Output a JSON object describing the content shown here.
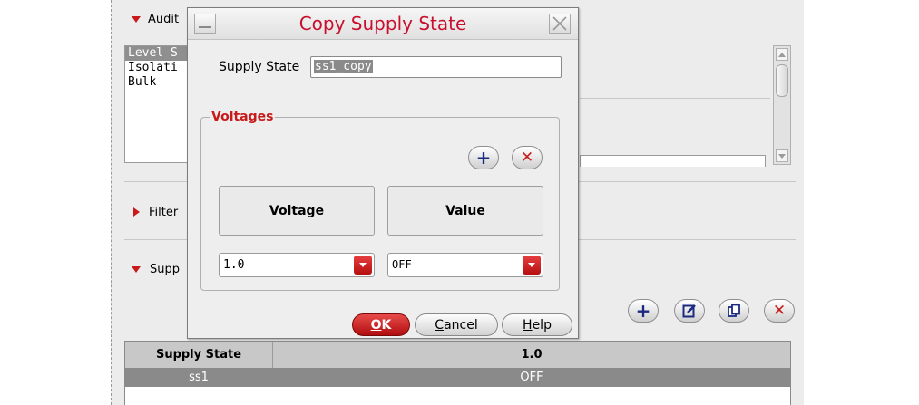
{
  "background": {
    "sections": {
      "audit_label": "Audit",
      "filter_label": "Filter",
      "supply_label": "Supp"
    },
    "list_items": [
      "Level S",
      "Isolati",
      "Bulk"
    ],
    "table": {
      "headers": [
        "Supply State",
        "1.0"
      ],
      "rows": [
        [
          "ss1",
          "OFF"
        ]
      ]
    }
  },
  "dialog": {
    "title": "Copy Supply State",
    "supply_state_label": "Supply State",
    "supply_state_value": "ss1_copy",
    "voltages_group_label": "Voltages",
    "column_headers": [
      "Voltage",
      "Value"
    ],
    "voltage_value": "1.0",
    "value_value": "OFF",
    "ok_label": "OK",
    "ok_underline": "O",
    "ok_rest": "K",
    "cancel_underline": "C",
    "cancel_rest": "ancel",
    "help_underline": "H",
    "help_rest": "elp"
  },
  "colors": {
    "accent_red": "#c81a1a",
    "title_red": "#c8102e",
    "selected_row_bg": "#8a8a8a",
    "table_header_bg": "#c8c8c8"
  },
  "icons": [
    "minimize-icon",
    "close-icon",
    "add-icon",
    "delete-icon",
    "edit-icon",
    "copy-icon"
  ]
}
